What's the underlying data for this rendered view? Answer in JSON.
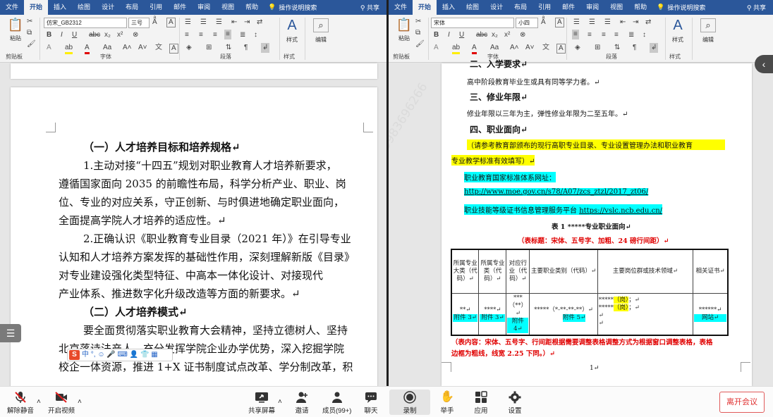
{
  "ribbon_tabs": [
    "文件",
    "开始",
    "插入",
    "绘图",
    "设计",
    "布局",
    "引用",
    "邮件",
    "审阅",
    "视图",
    "帮助"
  ],
  "tell_me": "操作说明搜索",
  "share": "共享",
  "left": {
    "font_name": "仿宋_GB2312",
    "font_size": "三号",
    "groups": {
      "clipboard": "剪贴板",
      "font": "字体",
      "paragraph": "段落",
      "styles": "样式",
      "editing": "编辑"
    },
    "paste": "粘贴",
    "styles_btn": "样式",
    "edit_btn": "编辑",
    "lines": [
      "（一）人才培养目标和培养规格↵",
      "1.主动对接“十四五”规划对职业教育人才培养新要求，",
      "遵循国家面向 2035 的前瞻性布局，科学分析产业、职业、岗",
      "位、专业的对应关系，守正创新、与时俱进地确定职业面向，",
      "全面提高学院人才培养的适应性。↵",
      "2.正确认识《职业教育专业目录（2021 年）》在引导专业",
      "认知和人才培养方案发挥的基础性作用，深刻理解新版《目录》",
      "对专业建设强化类型特征、中高本一体化设计、对接现代",
      "产业体系、推进数字化升级改造等方面的新要求。↵",
      "（二）人才培养模式↵",
      "要全面贯彻落实职业教育大会精神，坚持立德树人、坚持",
      "北京落诗法产人，充分发挥学院企业办学优势，深入挖掘学院",
      "校企一体资源，推进 1+X 证书制度试点改革、学分制改革，积"
    ]
  },
  "right": {
    "font_name": "宋体",
    "font_size": "小四",
    "groups": {
      "clipboard": "剪贴板",
      "font": "字体",
      "paragraph": "段落",
      "styles": "样式",
      "editing": "编辑"
    },
    "paste": "粘贴",
    "styles_btn": "样式",
    "edit_btn": "编辑",
    "h2_cut": "二、入学要求↵",
    "p_admission": "高中阶段教育毕业生或具有同等学力者。↵",
    "h3": "三、修业年限↵",
    "p_years": "修业年限以三年为主，弹性修业年限为二至五年。↵",
    "h4": "四、职业面向↵",
    "yellow_1": "（请参考教育部颁布的现行高职专业目录、专业设置管理办法和职业教育",
    "yellow_2": "专业教学标准有效填写）↵",
    "cyan_1": "职业教育国家标准体系网址：",
    "cyan_url": "http://www.moe.gov.cn/s78/A07/zcs_ztzl/2017_zt06/",
    "cyan_3a": "职业技能等级证书信息管理服务平台 ",
    "cyan_3b": "https://vslc.ncb.edu.cn/",
    "table_title": "表 1  *****专业职业面向↵",
    "table_note": "（表标题：宋体、五号字、加粗、24 磅行间距）↵",
    "headers": [
      "所属专业大类（代码）↵",
      "所属专业类（代码）↵",
      "对应行业（代码）↵",
      "主要职业类别（代码）↵",
      "主要岗位群或技术领域↵",
      "相关证书↵"
    ],
    "cells": {
      "c1a": "**↵",
      "c1b": "附件 3↵",
      "c2a": "****↵",
      "c2b": "附件 3↵",
      "c3a": "***（**）↵",
      "c3b": "附件 4↵",
      "c4a": "*****（*-**-**-**）↵",
      "c4b": "附件 5↵",
      "c5a": "*****",
      "c5a_hl": "（岗）",
      "c5a_end": "；↵",
      "c5b": "*****",
      "c5b_hl": "（岗）",
      "c5b_end": "；↵",
      "c5c": "↵",
      "c5d": "↵",
      "c6a": "******↵",
      "c6b": "网站↵"
    },
    "footer_note_1": "（表内容：宋体、五号字、行间距根据需要调整表格调整方式为根据窗口调整表格，表格",
    "footer_note_2": "边框为粗线，线宽 2.25 下同。）↵",
    "page_num": "1↵"
  },
  "watermark": [
    "刘玉",
    "13983696266"
  ],
  "ime_bar": "中 °, ☺ 🎤 ⌨ 👤 👕 ▦",
  "toolbar": {
    "unmute": "解除静音",
    "video": "开启视频",
    "share_screen": "共享屏幕",
    "invite": "邀请",
    "members": "成员(99+)",
    "chat": "聊天",
    "record": "录制",
    "raise_hand": "举手",
    "apps": "应用",
    "settings": "设置",
    "leave": "离开会议"
  }
}
